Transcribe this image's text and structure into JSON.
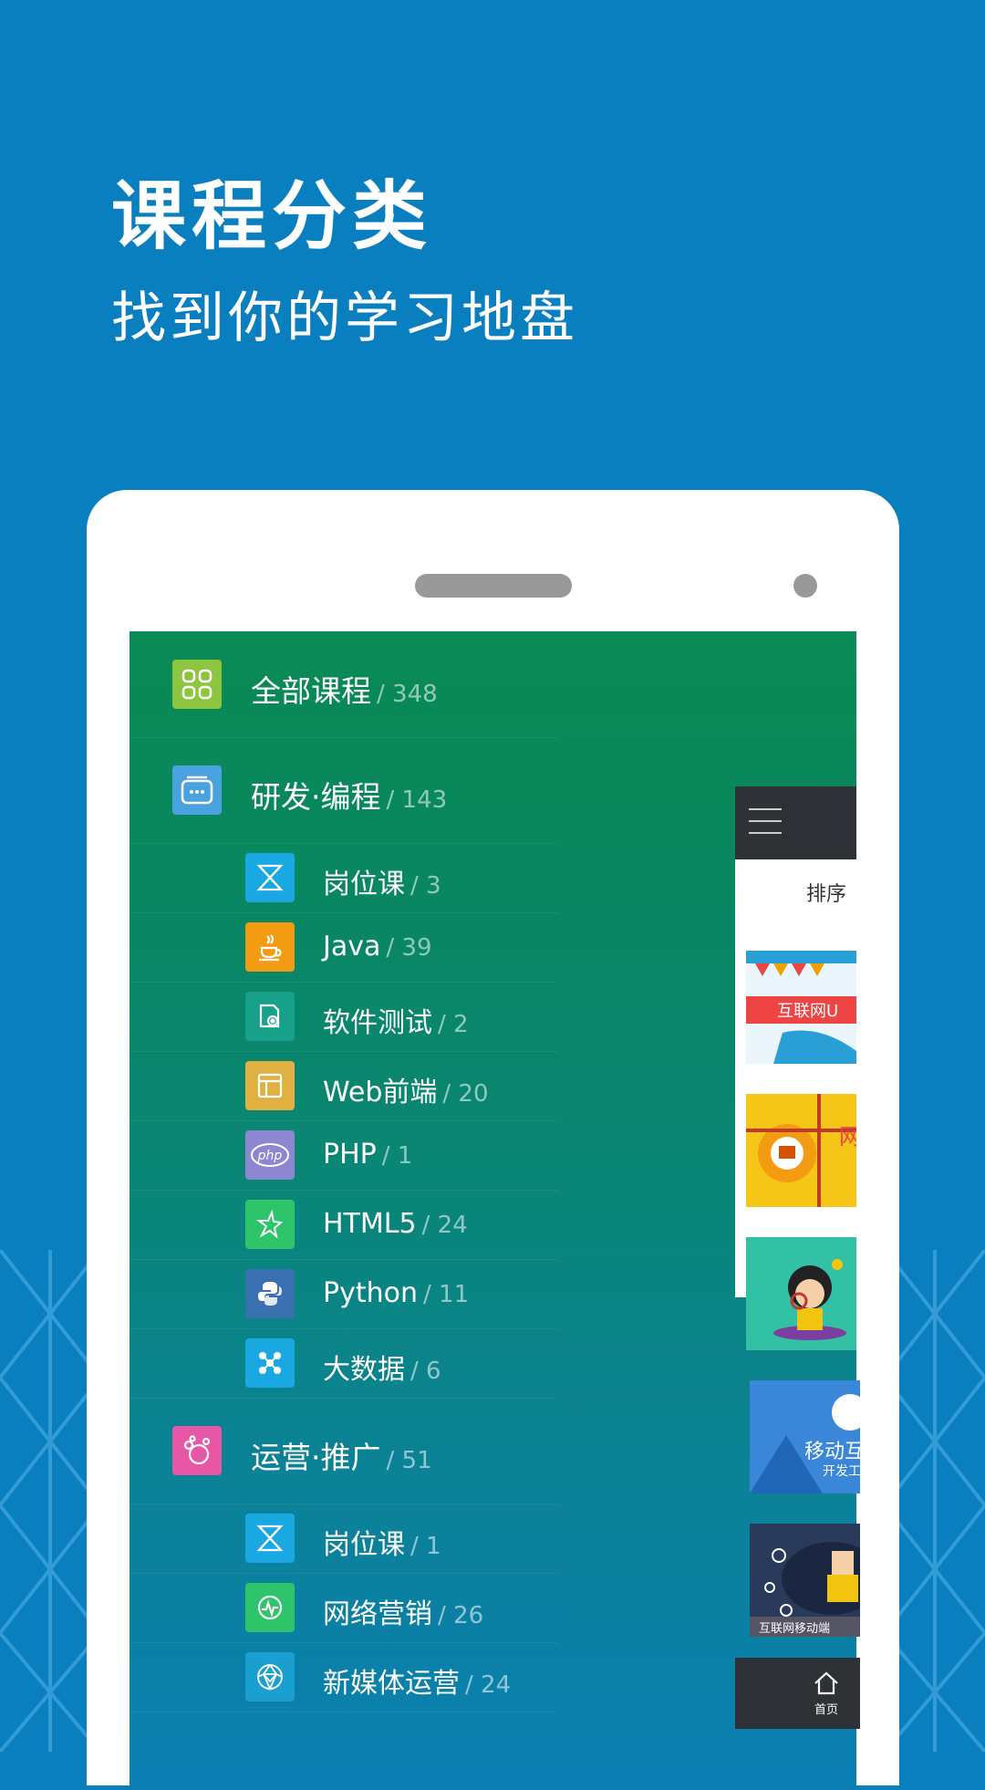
{
  "hero": {
    "title": "课程分类",
    "subtitle": "找到你的学习地盘"
  },
  "menu": {
    "all": {
      "label": "全部课程",
      "count": "/ 348",
      "icon": "grid-icon",
      "color": "#8cc63f"
    },
    "groups": [
      {
        "label": "研发·编程",
        "count": "/ 143",
        "icon": "window-icon",
        "color": "#4aa3df",
        "items": [
          {
            "label": "岗位课",
            "count": "/ 3",
            "icon": "hourglass-icon",
            "color": "#1aa8e2"
          },
          {
            "label": "Java",
            "count": "/ 39",
            "icon": "coffee-cup-icon",
            "color": "#f39c12"
          },
          {
            "label": "软件测试",
            "count": "/ 2",
            "icon": "test-doc-icon",
            "color": "#17a08a"
          },
          {
            "label": "Web前端",
            "count": "/ 20",
            "icon": "layout-icon",
            "color": "#e0b040"
          },
          {
            "label": "PHP",
            "count": "/ 1",
            "icon": "php-icon",
            "color": "#8f86d1"
          },
          {
            "label": "HTML5",
            "count": "/ 24",
            "icon": "star-icon",
            "color": "#2ec46a"
          },
          {
            "label": "Python",
            "count": "/ 11",
            "icon": "python-icon",
            "color": "#3a6fb0"
          },
          {
            "label": "大数据",
            "count": "/ 6",
            "icon": "cluster-icon",
            "color": "#1aa8e2"
          }
        ]
      },
      {
        "label": "运营·推广",
        "count": "/ 51",
        "icon": "bubbles-icon",
        "color": "#e857a6",
        "items": [
          {
            "label": "岗位课",
            "count": "/ 1",
            "icon": "hourglass-icon",
            "color": "#1aa8e2"
          },
          {
            "label": "网络营销",
            "count": "/ 26",
            "icon": "pulse-icon",
            "color": "#2ec46a"
          },
          {
            "label": "新媒体运营",
            "count": "/ 24",
            "icon": "network-icon",
            "color": "#1a9fd0"
          }
        ]
      }
    ]
  },
  "panel": {
    "sort_label": "排序",
    "thumbs": [
      {
        "caption": "互联网U",
        "color": "#e44"
      },
      {
        "caption": "网",
        "color": "#f0c020"
      },
      {
        "caption": "",
        "color": "#33c1a6"
      },
      {
        "caption": "移动互",
        "sub": "开发工",
        "color": "#3a86d8"
      },
      {
        "caption": "互联网移动端",
        "color": "#2a3a5a"
      }
    ],
    "home_label": "首页"
  }
}
